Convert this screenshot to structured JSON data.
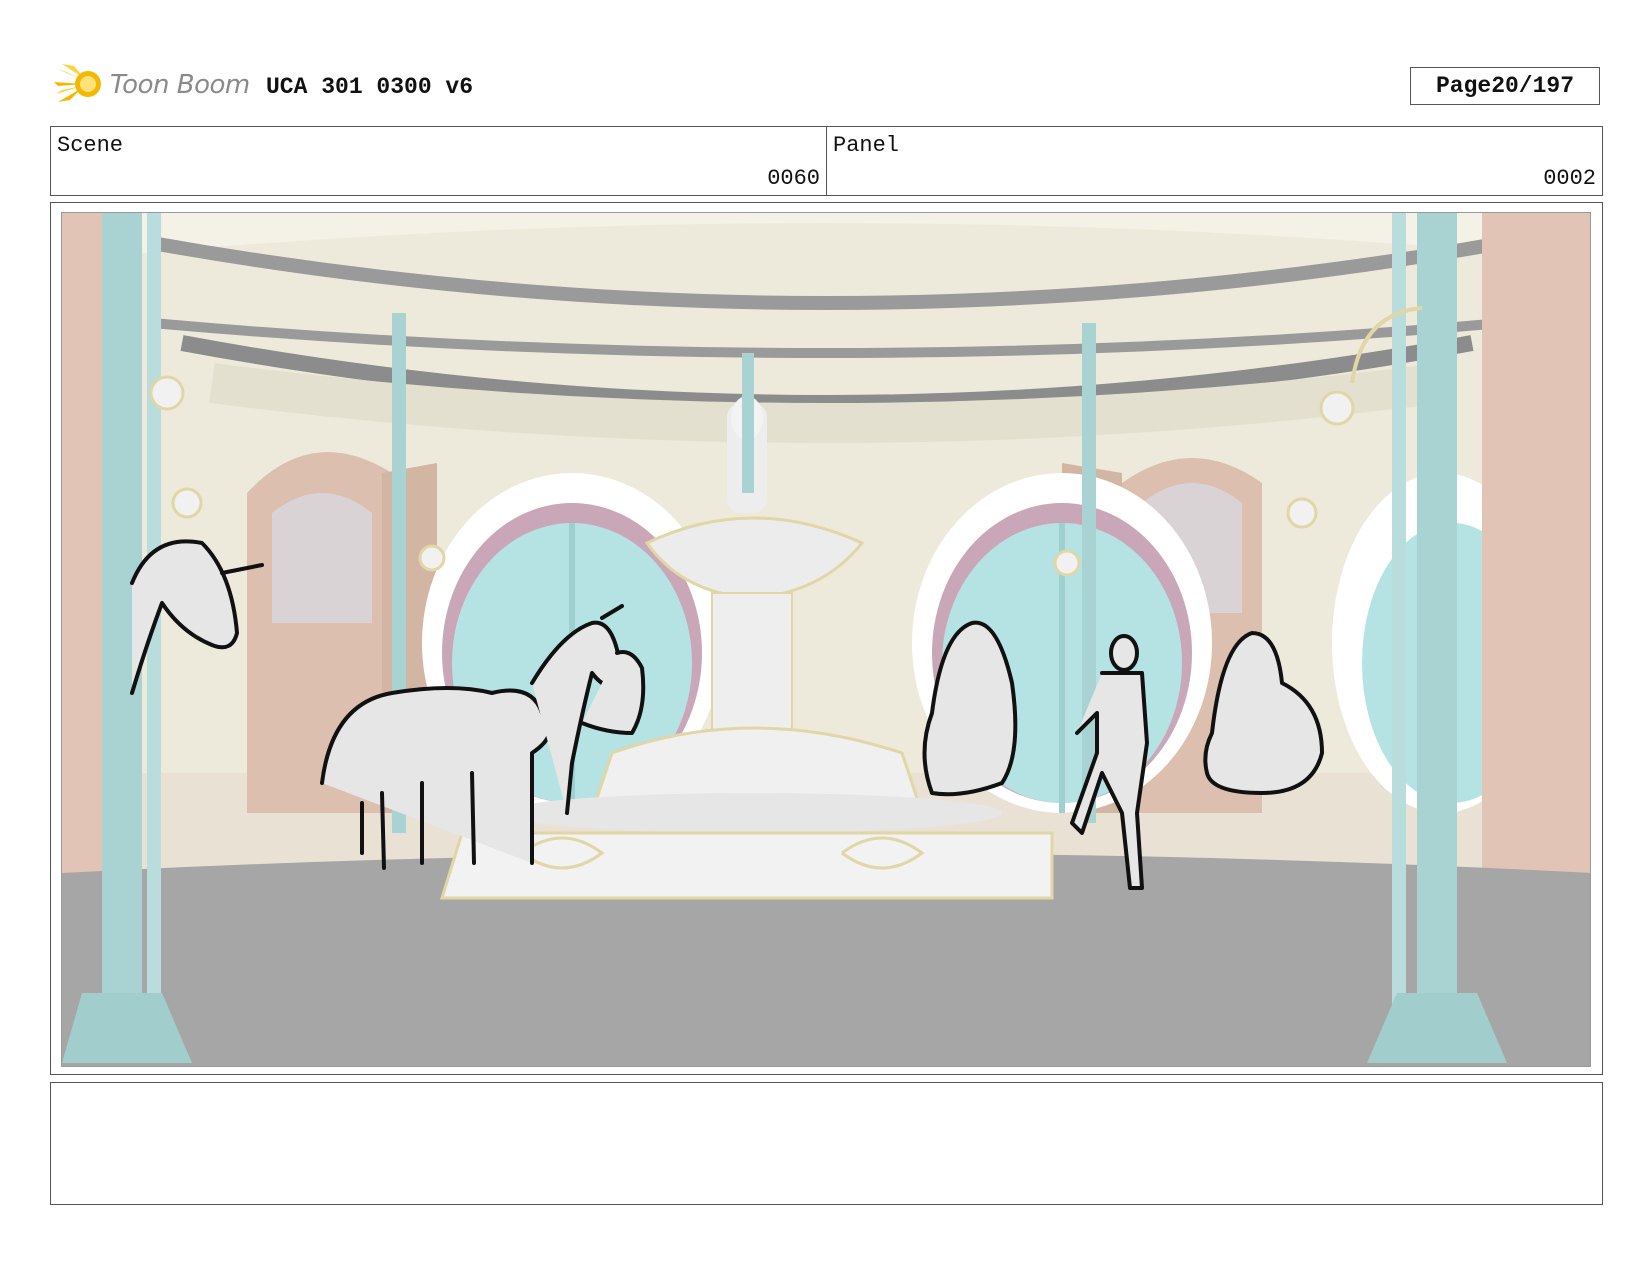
{
  "header": {
    "logo_text": "Toon Boom",
    "doc_title": "UCA 301 0300 v6",
    "page_label": "Page",
    "page_number": "20/197"
  },
  "info": {
    "scene_label": "Scene",
    "scene_value": "0060",
    "panel_label": "Panel",
    "panel_value": "0002"
  },
  "notes": {
    "text": ""
  },
  "colors": {
    "border": "#555555",
    "logo_accent": "#f5b800",
    "pillar": "#a9d3d3",
    "wall": "#efeadb",
    "window": "#b5e2e2",
    "door": "#d9b9a8",
    "floor": "#a6a6a6"
  }
}
